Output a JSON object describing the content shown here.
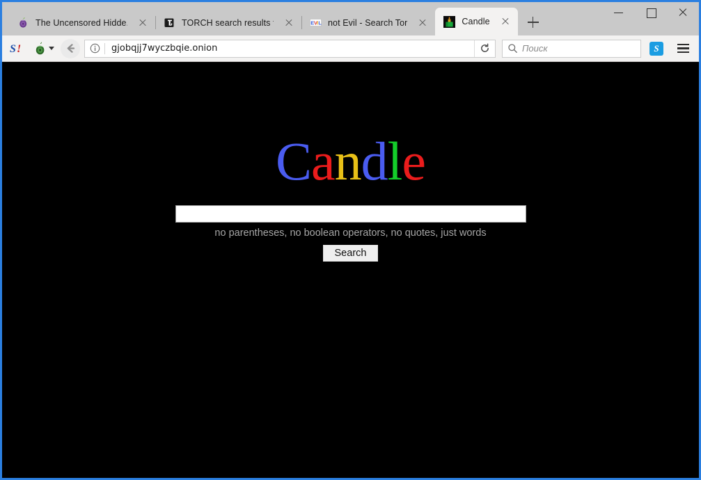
{
  "window": {
    "border_color": "#2b7fe0",
    "controls": {
      "minimize": "minimize-button",
      "maximize": "maximize-button",
      "close": "close-button"
    }
  },
  "tabs": [
    {
      "title": "The Uncensored Hidde...",
      "favicon": "tor-onion-icon",
      "active": false
    },
    {
      "title": "TORCH search results f...",
      "favicon": "torch-icon",
      "active": false
    },
    {
      "title": "not Evil - Search Tor",
      "favicon": "notevil-icon",
      "active": false
    },
    {
      "title": "Candle",
      "favicon": "candle-icon",
      "active": true
    }
  ],
  "newtab_label": "+",
  "toolbar": {
    "skype_left_label": "S!",
    "onion_button": "tor-onion-button",
    "back_button": "back-button",
    "info_button": "site-info-button",
    "url": "gjobqjj7wyczbqie.onion",
    "reload_button": "reload-button",
    "search_placeholder": "Поиск",
    "skype_right_label": "S",
    "menu_button": "menu-button"
  },
  "page": {
    "background": "#000000",
    "logo": {
      "text": "Candle",
      "letters": [
        {
          "char": "C",
          "color": "#4a5cf0"
        },
        {
          "char": "a",
          "color": "#ea1c1c"
        },
        {
          "char": "n",
          "color": "#e8c017"
        },
        {
          "char": "d",
          "color": "#4a5cf0"
        },
        {
          "char": "l",
          "color": "#14cd2a"
        },
        {
          "char": "e",
          "color": "#ea1c1c"
        }
      ]
    },
    "search_value": "",
    "search_placeholder": "",
    "hint": "no parentheses, no boolean operators, no quotes, just words",
    "search_button_label": "Search"
  }
}
